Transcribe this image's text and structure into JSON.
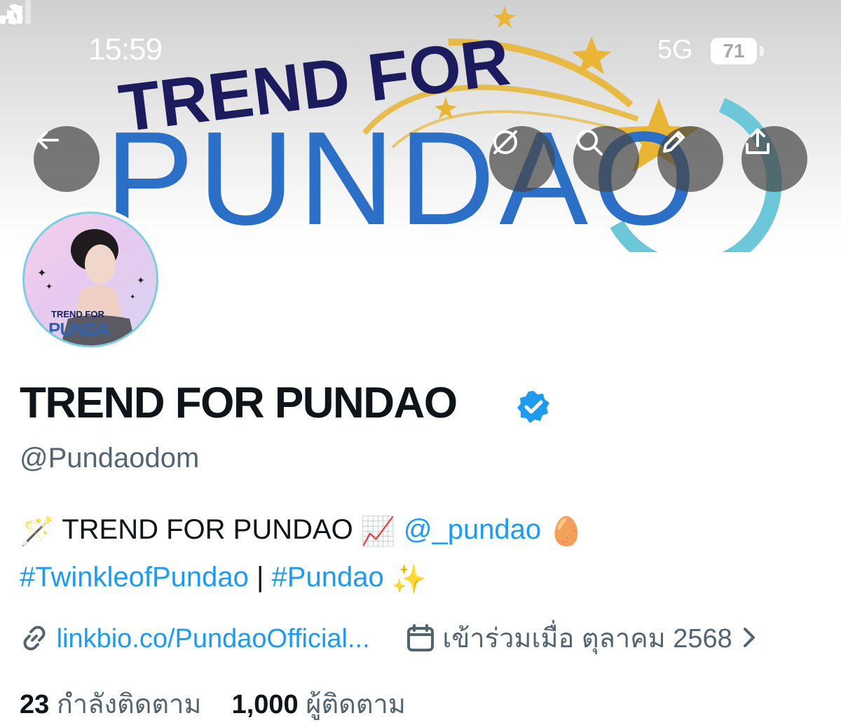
{
  "status_bar": {
    "time": "15:59",
    "network": "5G",
    "battery": "71"
  },
  "banner": {
    "title_top": "TREND FOR",
    "title_bottom": "PUNDAO"
  },
  "actions": {
    "back_icon": "arrow-left-icon",
    "icons": [
      "grok-icon",
      "search-icon",
      "edit-icon",
      "share-icon"
    ]
  },
  "avatar": {
    "line1": "TREND FOR",
    "line2": "PUNDA"
  },
  "profile": {
    "display_name": "TREND FOR PUNDAO",
    "handle": "@Pundaodom",
    "bio": {
      "wand_emoji": "🪄",
      "text1": "TREND FOR PUNDAO",
      "chart_emoji": "📈",
      "mention": "@_pundao",
      "egg_emoji": "🥚",
      "hashtag1": "#TwinkleofPundao",
      "separator": "|",
      "hashtag2": "#Pundao",
      "sparkle_emoji": "✨"
    },
    "link": "linkbio.co/PundaoOfficial...",
    "joined": "เข้าร่วมเมื่อ ตุลาคม 2568",
    "following_count": "23",
    "following_label": "กำลังติดตาม",
    "followers_count": "1,000",
    "followers_label": "ผู้ติดตาม"
  },
  "colors": {
    "link": "#1d9bf0",
    "verified": "#1d9bf0",
    "secondary_text": "#536471"
  }
}
